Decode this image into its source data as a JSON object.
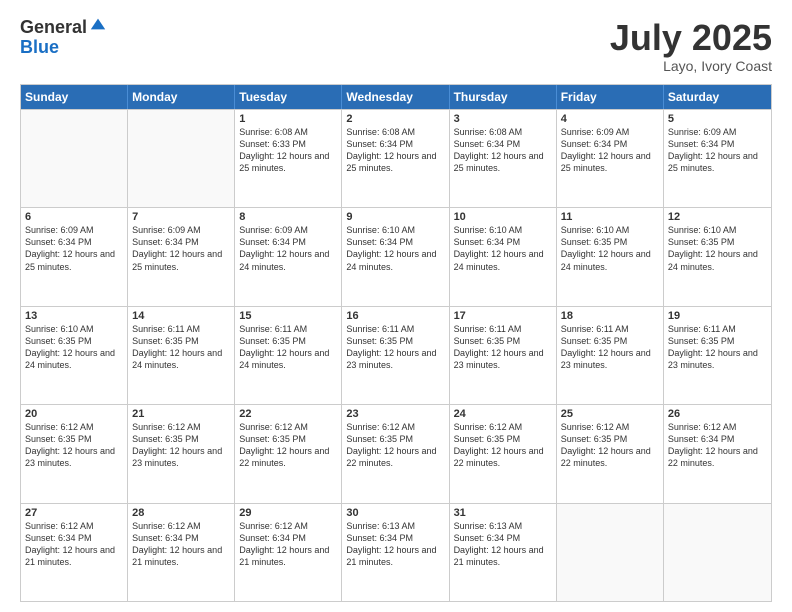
{
  "logo": {
    "general": "General",
    "blue": "Blue"
  },
  "title": "July 2025",
  "subtitle": "Layo, Ivory Coast",
  "header_days": [
    "Sunday",
    "Monday",
    "Tuesday",
    "Wednesday",
    "Thursday",
    "Friday",
    "Saturday"
  ],
  "weeks": [
    [
      {
        "day": "",
        "info": ""
      },
      {
        "day": "",
        "info": ""
      },
      {
        "day": "1",
        "info": "Sunrise: 6:08 AM\nSunset: 6:33 PM\nDaylight: 12 hours and 25 minutes."
      },
      {
        "day": "2",
        "info": "Sunrise: 6:08 AM\nSunset: 6:34 PM\nDaylight: 12 hours and 25 minutes."
      },
      {
        "day": "3",
        "info": "Sunrise: 6:08 AM\nSunset: 6:34 PM\nDaylight: 12 hours and 25 minutes."
      },
      {
        "day": "4",
        "info": "Sunrise: 6:09 AM\nSunset: 6:34 PM\nDaylight: 12 hours and 25 minutes."
      },
      {
        "day": "5",
        "info": "Sunrise: 6:09 AM\nSunset: 6:34 PM\nDaylight: 12 hours and 25 minutes."
      }
    ],
    [
      {
        "day": "6",
        "info": "Sunrise: 6:09 AM\nSunset: 6:34 PM\nDaylight: 12 hours and 25 minutes."
      },
      {
        "day": "7",
        "info": "Sunrise: 6:09 AM\nSunset: 6:34 PM\nDaylight: 12 hours and 25 minutes."
      },
      {
        "day": "8",
        "info": "Sunrise: 6:09 AM\nSunset: 6:34 PM\nDaylight: 12 hours and 24 minutes."
      },
      {
        "day": "9",
        "info": "Sunrise: 6:10 AM\nSunset: 6:34 PM\nDaylight: 12 hours and 24 minutes."
      },
      {
        "day": "10",
        "info": "Sunrise: 6:10 AM\nSunset: 6:34 PM\nDaylight: 12 hours and 24 minutes."
      },
      {
        "day": "11",
        "info": "Sunrise: 6:10 AM\nSunset: 6:35 PM\nDaylight: 12 hours and 24 minutes."
      },
      {
        "day": "12",
        "info": "Sunrise: 6:10 AM\nSunset: 6:35 PM\nDaylight: 12 hours and 24 minutes."
      }
    ],
    [
      {
        "day": "13",
        "info": "Sunrise: 6:10 AM\nSunset: 6:35 PM\nDaylight: 12 hours and 24 minutes."
      },
      {
        "day": "14",
        "info": "Sunrise: 6:11 AM\nSunset: 6:35 PM\nDaylight: 12 hours and 24 minutes."
      },
      {
        "day": "15",
        "info": "Sunrise: 6:11 AM\nSunset: 6:35 PM\nDaylight: 12 hours and 24 minutes."
      },
      {
        "day": "16",
        "info": "Sunrise: 6:11 AM\nSunset: 6:35 PM\nDaylight: 12 hours and 23 minutes."
      },
      {
        "day": "17",
        "info": "Sunrise: 6:11 AM\nSunset: 6:35 PM\nDaylight: 12 hours and 23 minutes."
      },
      {
        "day": "18",
        "info": "Sunrise: 6:11 AM\nSunset: 6:35 PM\nDaylight: 12 hours and 23 minutes."
      },
      {
        "day": "19",
        "info": "Sunrise: 6:11 AM\nSunset: 6:35 PM\nDaylight: 12 hours and 23 minutes."
      }
    ],
    [
      {
        "day": "20",
        "info": "Sunrise: 6:12 AM\nSunset: 6:35 PM\nDaylight: 12 hours and 23 minutes."
      },
      {
        "day": "21",
        "info": "Sunrise: 6:12 AM\nSunset: 6:35 PM\nDaylight: 12 hours and 23 minutes."
      },
      {
        "day": "22",
        "info": "Sunrise: 6:12 AM\nSunset: 6:35 PM\nDaylight: 12 hours and 22 minutes."
      },
      {
        "day": "23",
        "info": "Sunrise: 6:12 AM\nSunset: 6:35 PM\nDaylight: 12 hours and 22 minutes."
      },
      {
        "day": "24",
        "info": "Sunrise: 6:12 AM\nSunset: 6:35 PM\nDaylight: 12 hours and 22 minutes."
      },
      {
        "day": "25",
        "info": "Sunrise: 6:12 AM\nSunset: 6:35 PM\nDaylight: 12 hours and 22 minutes."
      },
      {
        "day": "26",
        "info": "Sunrise: 6:12 AM\nSunset: 6:34 PM\nDaylight: 12 hours and 22 minutes."
      }
    ],
    [
      {
        "day": "27",
        "info": "Sunrise: 6:12 AM\nSunset: 6:34 PM\nDaylight: 12 hours and 21 minutes."
      },
      {
        "day": "28",
        "info": "Sunrise: 6:12 AM\nSunset: 6:34 PM\nDaylight: 12 hours and 21 minutes."
      },
      {
        "day": "29",
        "info": "Sunrise: 6:12 AM\nSunset: 6:34 PM\nDaylight: 12 hours and 21 minutes."
      },
      {
        "day": "30",
        "info": "Sunrise: 6:13 AM\nSunset: 6:34 PM\nDaylight: 12 hours and 21 minutes."
      },
      {
        "day": "31",
        "info": "Sunrise: 6:13 AM\nSunset: 6:34 PM\nDaylight: 12 hours and 21 minutes."
      },
      {
        "day": "",
        "info": ""
      },
      {
        "day": "",
        "info": ""
      }
    ]
  ]
}
